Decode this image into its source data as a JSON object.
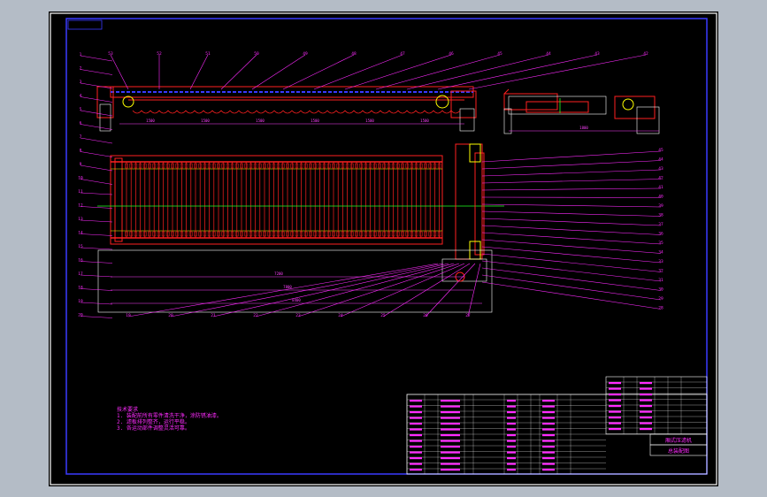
{
  "colors": {
    "frame": "#ffffff",
    "border_blue": "#3a3aff",
    "part": "#ff2020",
    "leader": "#ff2bff",
    "centerline": "#22ff22",
    "highlight": "#ffff00",
    "dim": "#ff40ff"
  },
  "notes": {
    "title": "技术要求",
    "lines": [
      "1. 装配前所有零件清洗干净，涂防锈油漆。",
      "2. 滤板排列整齐，运行平稳。",
      "3. 各运动部件调整灵活可靠。"
    ]
  },
  "title_block": {
    "drawing_title": "厢式压滤机",
    "drawing_no": "总装配图"
  },
  "labels_left": [
    "1",
    "2",
    "3",
    "4",
    "5",
    "6",
    "7",
    "8",
    "9",
    "10",
    "11",
    "12",
    "13",
    "14",
    "15",
    "16",
    "17",
    "18",
    "19",
    "20"
  ],
  "labels_right": [
    "45",
    "44",
    "43",
    "42",
    "41",
    "40",
    "39",
    "38",
    "37",
    "36",
    "35",
    "34",
    "33",
    "32",
    "31",
    "30",
    "29",
    "28"
  ],
  "labels_top": [
    "53",
    "52",
    "51",
    "50",
    "49",
    "48",
    "47",
    "46",
    "45",
    "44",
    "43",
    "42"
  ],
  "labels_bottom": [
    "19",
    "20",
    "21",
    "22",
    "23",
    "24",
    "25",
    "26",
    "27"
  ],
  "dims": {
    "top_lengths": [
      "1500",
      "1500",
      "1500",
      "1500",
      "1500",
      "1500"
    ],
    "side_width": "1800",
    "plan_length_1": "7200",
    "plan_length_2": "7800",
    "plan_length_3": "8400"
  }
}
